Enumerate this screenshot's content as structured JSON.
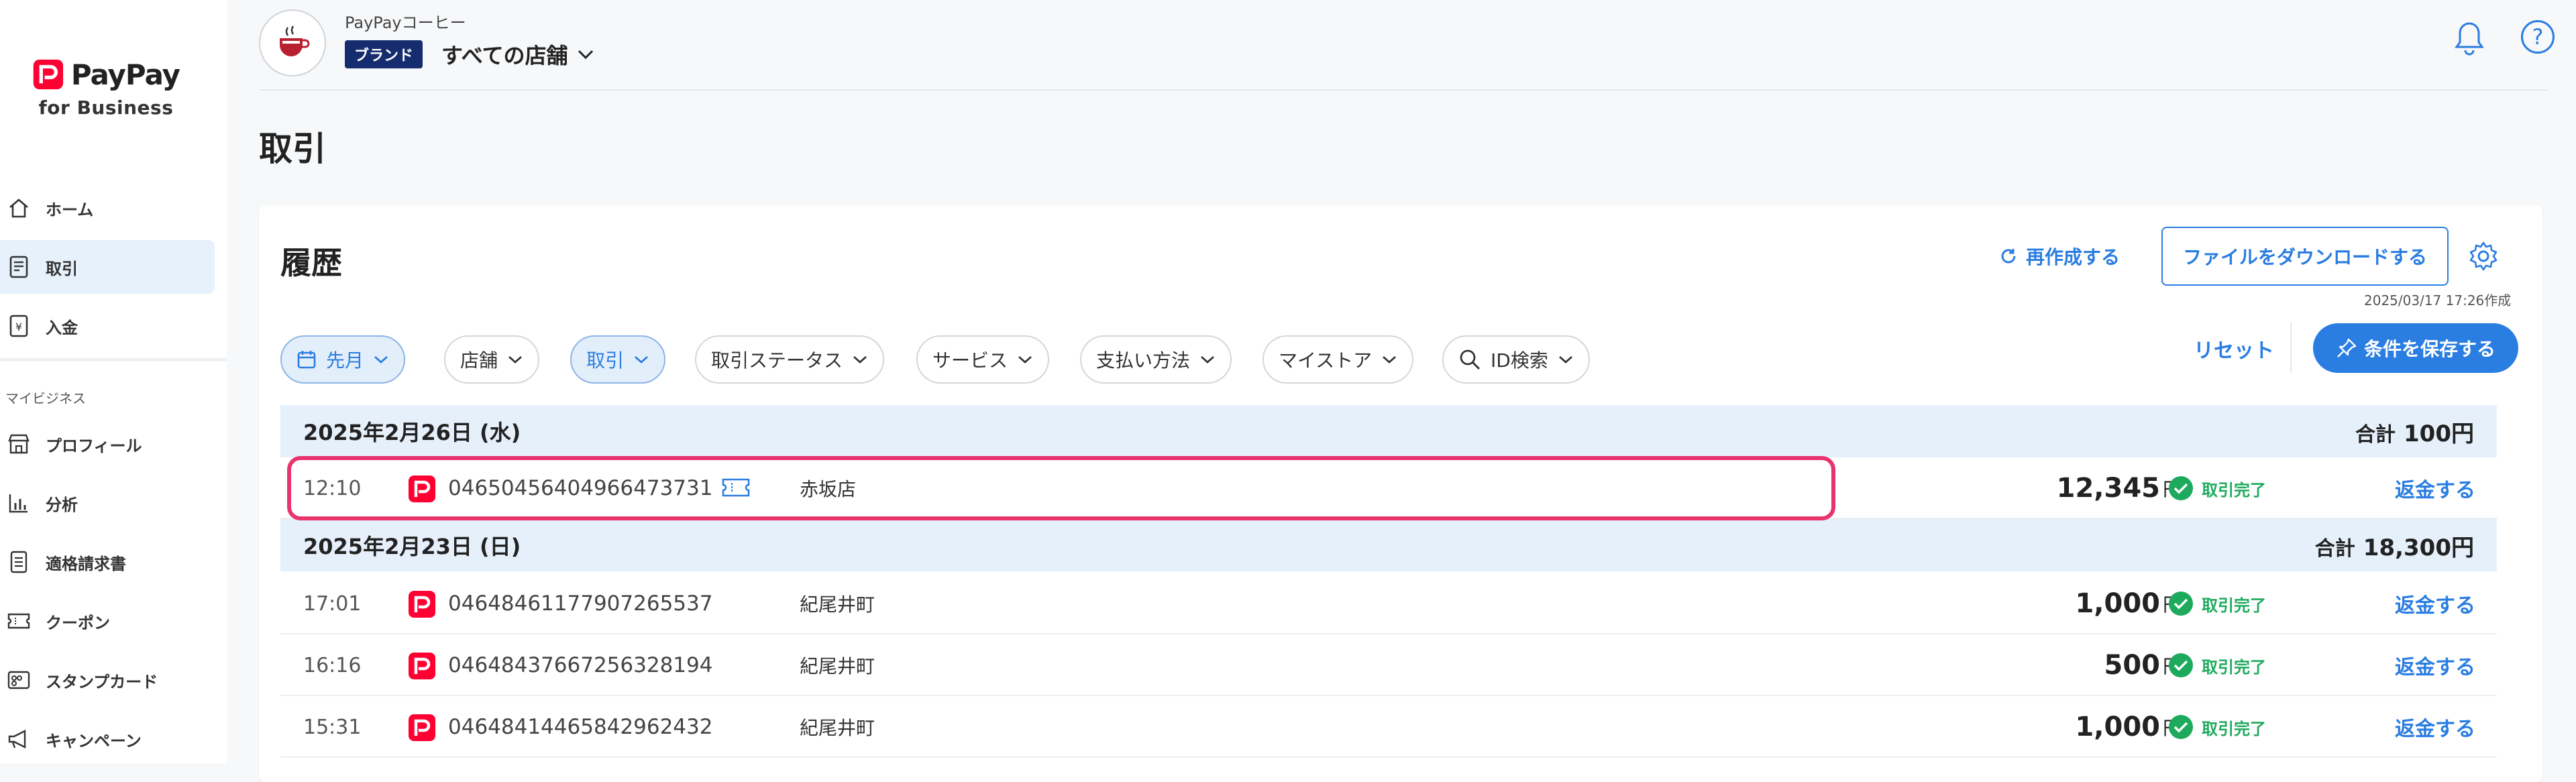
{
  "sidebar": {
    "brand_name": "PayPay",
    "brand_sub": "for Business",
    "items": [
      {
        "label": "ホーム",
        "icon": "home-icon"
      },
      {
        "label": "取引",
        "icon": "receipt-icon",
        "active": true
      },
      {
        "label": "入金",
        "icon": "yen-icon"
      }
    ],
    "section_label": "マイビジネス",
    "business_items": [
      {
        "label": "プロフィール",
        "icon": "store-icon"
      },
      {
        "label": "分析",
        "icon": "bar-chart-icon"
      },
      {
        "label": "適格請求書",
        "icon": "document-icon"
      },
      {
        "label": "クーポン",
        "icon": "coupon-icon"
      },
      {
        "label": "スタンプカード",
        "icon": "stamp-card-icon"
      },
      {
        "label": "キャンペーン",
        "icon": "megaphone-icon"
      }
    ]
  },
  "header": {
    "company_name": "PayPayコーヒー",
    "brand_badge": "ブランド",
    "store_selector": "すべての店舗",
    "help_label": "?"
  },
  "page": {
    "title": "取引"
  },
  "history": {
    "title": "履歴",
    "recreate_label": "再作成する",
    "download_label": "ファイルをダウンロードする",
    "created_at": "2025/03/17 17:26作成",
    "filters": [
      {
        "label": "先月",
        "active": true,
        "icon": "calendar-icon"
      },
      {
        "label": "店舗",
        "active": false
      },
      {
        "label": "取引",
        "active": true
      },
      {
        "label": "取引ステータス",
        "active": false
      },
      {
        "label": "サービス",
        "active": false
      },
      {
        "label": "支払い方法",
        "active": false
      },
      {
        "label": "マイストア",
        "active": false
      },
      {
        "label": "ID検索",
        "active": false,
        "icon": "search-icon"
      }
    ],
    "reset_label": "リセット",
    "save_label": "条件を保存する",
    "total_prefix": "合計",
    "currency": "円",
    "groups": [
      {
        "date": "2025年2月26日 (水)",
        "total": "100円",
        "rows": [
          {
            "time": "12:10",
            "id": "04650456404966473731",
            "store": "赤坂店",
            "amount": "12,345",
            "status": "取引完了",
            "refund": "返金する",
            "coupon": true
          }
        ]
      },
      {
        "date": "2025年2月23日 (日)",
        "total": "18,300円",
        "rows": [
          {
            "time": "17:01",
            "id": "04648461177907265537",
            "store": "紀尾井町",
            "amount": "1,000",
            "status": "取引完了",
            "refund": "返金する"
          },
          {
            "time": "16:16",
            "id": "04648437667256328194",
            "store": "紀尾井町",
            "amount": "500",
            "status": "取引完了",
            "refund": "返金する"
          },
          {
            "time": "15:31",
            "id": "04648414465842962432",
            "store": "紀尾井町",
            "amount": "1,000",
            "status": "取引完了",
            "refund": "返金する"
          }
        ]
      }
    ]
  },
  "colors": {
    "accent": "#2a7de1",
    "brand_red": "#ff0033",
    "success": "#1eaa5d",
    "highlight": "#e8336d",
    "badge_navy": "#152d6e"
  }
}
